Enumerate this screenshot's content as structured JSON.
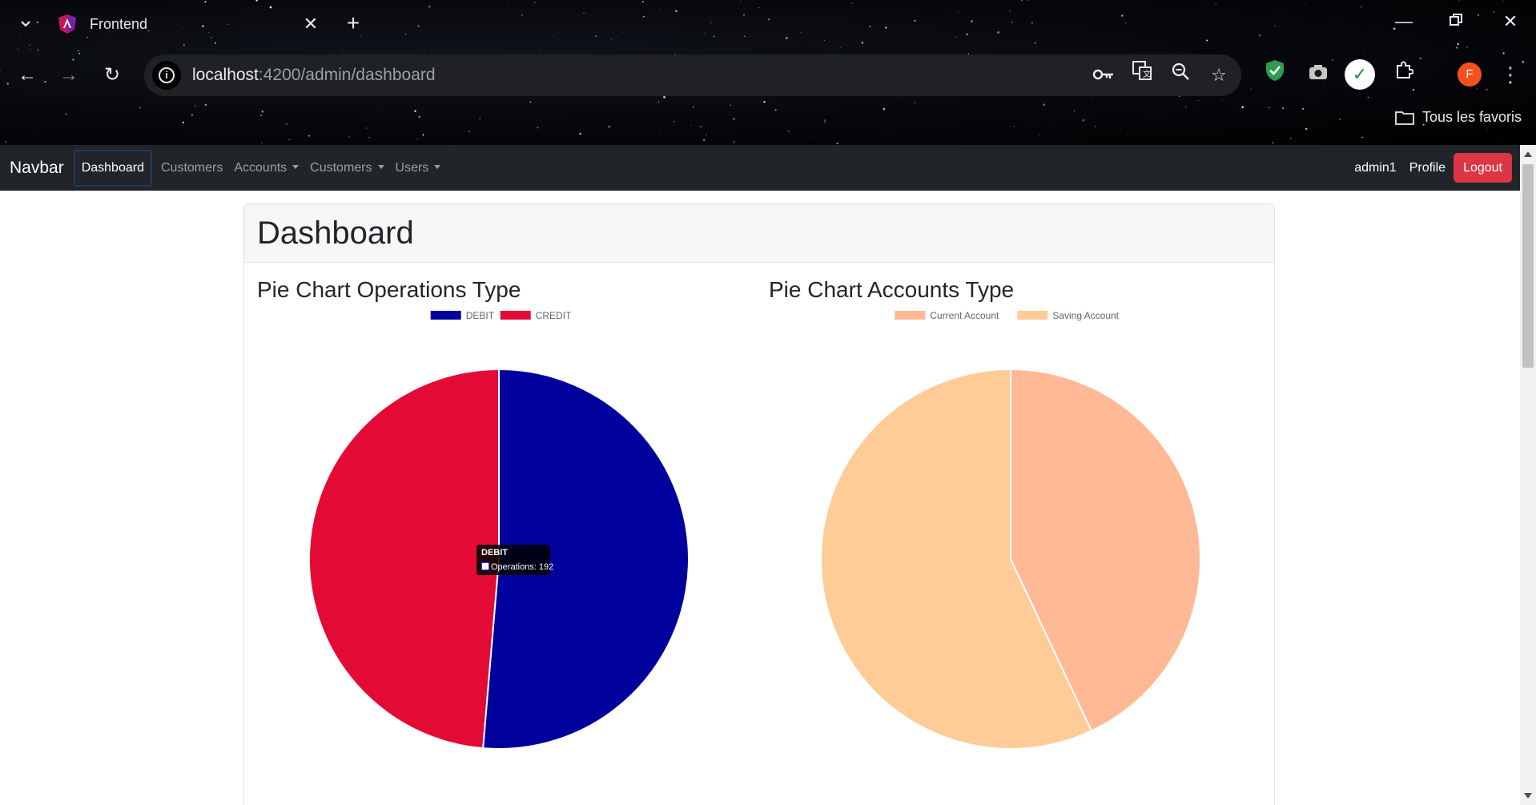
{
  "browser": {
    "tab_title": "Frontend",
    "url_host": "localhost",
    "url_path": ":4200/admin/dashboard",
    "bookmarks_label": "Tous les favoris",
    "avatar_letter": "F"
  },
  "navbar": {
    "brand": "Navbar",
    "links": [
      {
        "label": "Dashboard",
        "active": true,
        "dropdown": false
      },
      {
        "label": "Customers",
        "active": false,
        "dropdown": false
      },
      {
        "label": "Accounts",
        "active": false,
        "dropdown": true
      },
      {
        "label": "Customers",
        "active": false,
        "dropdown": true
      },
      {
        "label": "Users",
        "active": false,
        "dropdown": true
      }
    ],
    "username": "admin1",
    "profile": "Profile",
    "logout": "Logout"
  },
  "page": {
    "title": "Dashboard"
  },
  "chart_data": [
    {
      "type": "pie",
      "title": "Pie Chart Operations Type",
      "categories": [
        "DEBIT",
        "CREDIT"
      ],
      "values": [
        192,
        182
      ],
      "colors": [
        "#00009c",
        "#e30b36"
      ],
      "legend": "top",
      "tooltip": {
        "title": "DEBIT",
        "label": "Operations: 192"
      }
    },
    {
      "type": "pie",
      "title": "Pie Chart Accounts Type",
      "categories": [
        "Current Account",
        "Saving Account"
      ],
      "values": [
        43,
        57
      ],
      "colors": [
        "#ffb995",
        "#ffcb97"
      ],
      "legend": "top"
    }
  ]
}
